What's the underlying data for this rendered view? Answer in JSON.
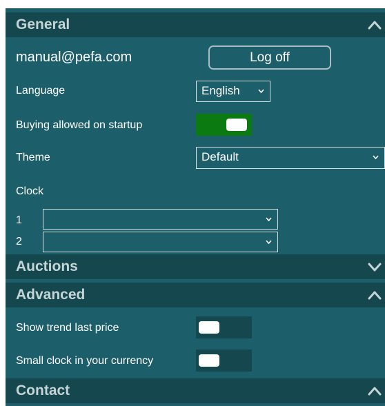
{
  "sections": {
    "general": {
      "title": "General",
      "account": {
        "email": "manual@pefa.com",
        "logoff_label": "Log off"
      },
      "language": {
        "label": "Language",
        "value": "English"
      },
      "buying_on_startup": {
        "label": "Buying allowed on startup",
        "enabled": true
      },
      "theme": {
        "label": "Theme",
        "value": "Default"
      },
      "clock": {
        "label": "Clock",
        "slots": [
          {
            "number": "1",
            "value": ""
          },
          {
            "number": "2",
            "value": ""
          }
        ]
      }
    },
    "auctions": {
      "title": "Auctions"
    },
    "advanced": {
      "title": "Advanced",
      "show_trend": {
        "label": "Show trend last price",
        "enabled": false
      },
      "small_clock": {
        "label": "Small clock in your currency",
        "enabled": false
      }
    },
    "contact": {
      "title": "Contact"
    }
  },
  "colors": {
    "panel": "#1c5f6b",
    "header": "#15474f",
    "toggle_on": "#0b7a10",
    "toggle_off": "#15474f",
    "header_text": "#c5d4d5"
  },
  "icons": {
    "expanded": "chevron-up-icon",
    "collapsed": "chevron-down-icon",
    "dropdown": "dropdown-caret-icon"
  }
}
